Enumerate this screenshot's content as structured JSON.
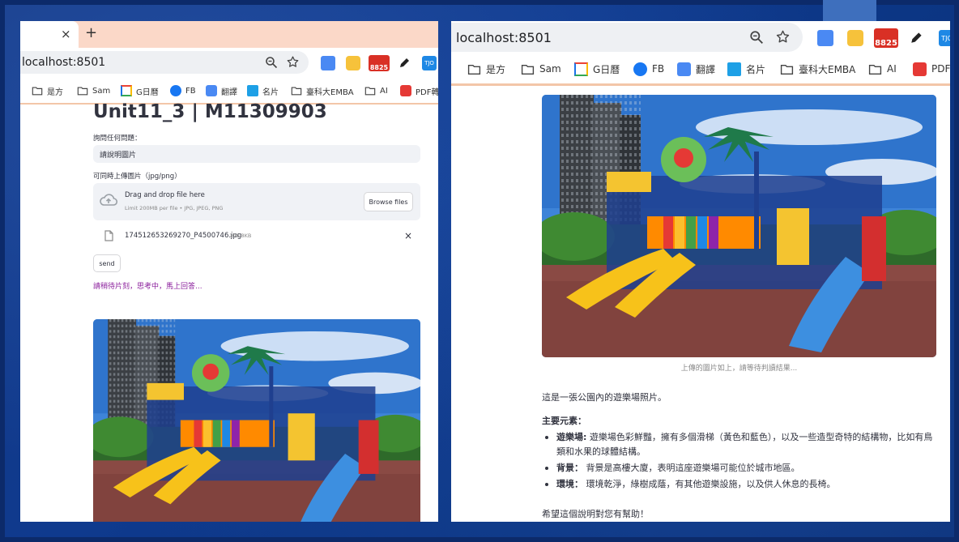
{
  "left_window": {
    "browser": {
      "url": "localhost:8501",
      "tab_close": "×",
      "new_tab": "+",
      "notif_count": "8825",
      "ext_tj": "TJO",
      "bookmarks": [
        {
          "label": "是方",
          "icon": "folder-icon"
        },
        {
          "label": "Sam",
          "icon": "folder-icon"
        },
        {
          "label": "G日曆",
          "icon": "calendar-icon"
        },
        {
          "label": "FB",
          "icon": "facebook-icon"
        },
        {
          "label": "翻譯",
          "icon": "translate-icon"
        },
        {
          "label": "名片",
          "icon": "card-icon"
        },
        {
          "label": "臺科大EMBA",
          "icon": "folder-icon"
        },
        {
          "label": "AI",
          "icon": "folder-icon"
        },
        {
          "label": "PDF轉",
          "icon": "pdf-icon"
        }
      ]
    },
    "app": {
      "title": "Unit11_3 | M11309903",
      "question_label": "詢問任何問題：",
      "question_value": "請說明圖片",
      "upload_label": "可同時上傳圖片（jpg/png）",
      "dropzone_title": "Drag and drop file here",
      "dropzone_limit": "Limit 200MB per file • JPG, JPEG, PNG",
      "browse_label": "Browse files",
      "file_name": "174512653269270_P4500746.jpg",
      "file_size": "100.8KB",
      "file_remove": "×",
      "send_label": "send",
      "status_text": "請稍待片刻，思考中，馬上回答..."
    }
  },
  "right_window": {
    "browser": {
      "url": "localhost:8501",
      "notif_count": "8825",
      "ext_tj": "TJO",
      "bookmarks": [
        {
          "label": "是方",
          "icon": "folder-icon"
        },
        {
          "label": "Sam",
          "icon": "folder-icon"
        },
        {
          "label": "G日曆",
          "icon": "calendar-icon"
        },
        {
          "label": "FB",
          "icon": "facebook-icon"
        },
        {
          "label": "翻譯",
          "icon": "translate-icon"
        },
        {
          "label": "名片",
          "icon": "card-icon"
        },
        {
          "label": "臺科大EMBA",
          "icon": "folder-icon"
        },
        {
          "label": "AI",
          "icon": "folder-icon"
        },
        {
          "label": "PDF",
          "icon": "pdf-icon"
        }
      ]
    },
    "app": {
      "image_caption": "上傳的圖片如上，請等待判讀結果...",
      "intro": "這是一張公園內的遊樂場照片。",
      "section_title": "主要元素：",
      "elements": [
        {
          "term": "遊樂場:",
          "text": " 遊樂場色彩鮮豔，擁有多個滑梯（黃色和藍色），以及一些造型奇特的結構物，比如有鳥類和水果的球體結構。"
        },
        {
          "term": "背景：",
          "text": " 背景是高樓大廈，表明這座遊樂場可能位於城市地區。"
        },
        {
          "term": "環境：",
          "text": " 環境乾淨，綠樹成蔭，有其他遊樂設施，以及供人休息的長椅。"
        }
      ],
      "closing": "希望這個說明對您有幫助！"
    }
  },
  "colors": {
    "status_purple": "#8b1f9c",
    "toolbar_accent": "#f3c6a8",
    "tabstrip": "#fbd8c8",
    "background_blue": "#0f3a8e"
  }
}
